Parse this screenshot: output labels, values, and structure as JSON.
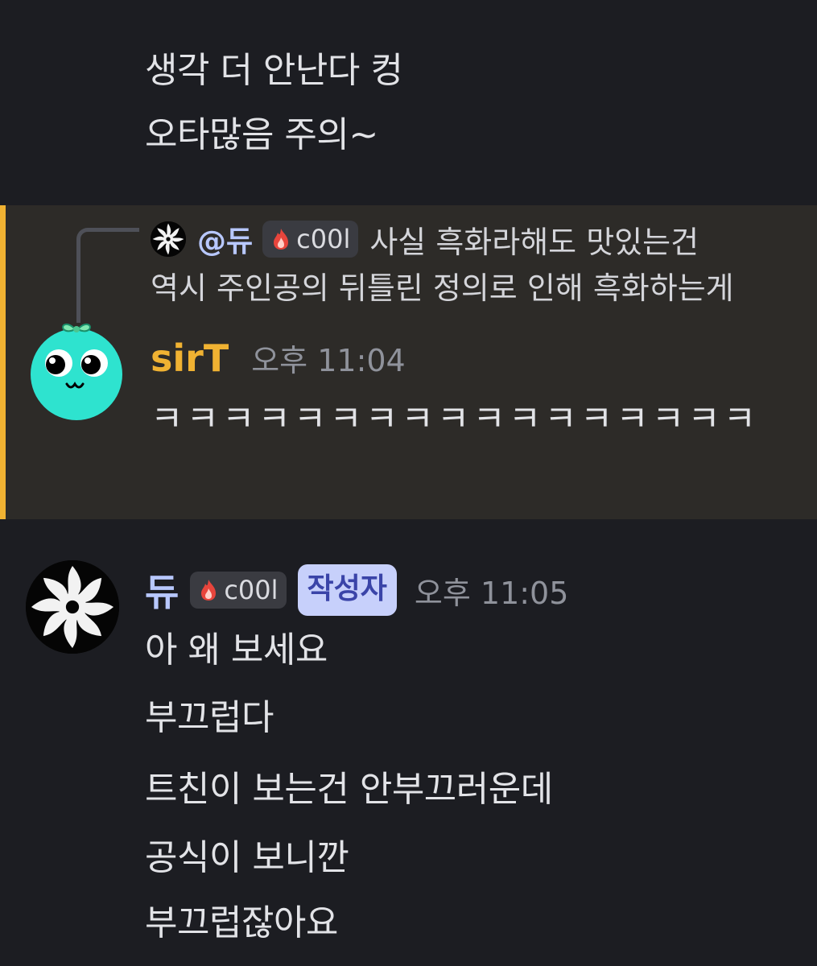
{
  "top_message": {
    "lines": [
      "생각 더 안난다 컹",
      "오타많음 주의~"
    ]
  },
  "mention_message": {
    "highlight_color": "#f0b232",
    "reply": {
      "author": "@듀",
      "tag": "c00l",
      "text_line1": "사실 흑화라해도 맛있는건",
      "text_line2": "역시 주인공의 뒤틀린 정의로 인해 흑화하는게"
    },
    "author": "sirT",
    "author_color": "#f0b232",
    "timestamp": "오후 11:04",
    "text": "ㅋㅋㅋㅋㅋㅋㅋㅋㅋㅋㅋㅋㅋㅋㅋㅋㅋ"
  },
  "main_message": {
    "author": "듀",
    "author_color": "#b8c8ff",
    "tag": "c00l",
    "badge": "작성자",
    "timestamp": "오후 11:05",
    "lines": [
      "아 왜 보세요",
      "부끄럽다",
      "트친이 보는건 안부끄러운데",
      "공식이 보니깐",
      "부끄럽잖아요"
    ]
  }
}
